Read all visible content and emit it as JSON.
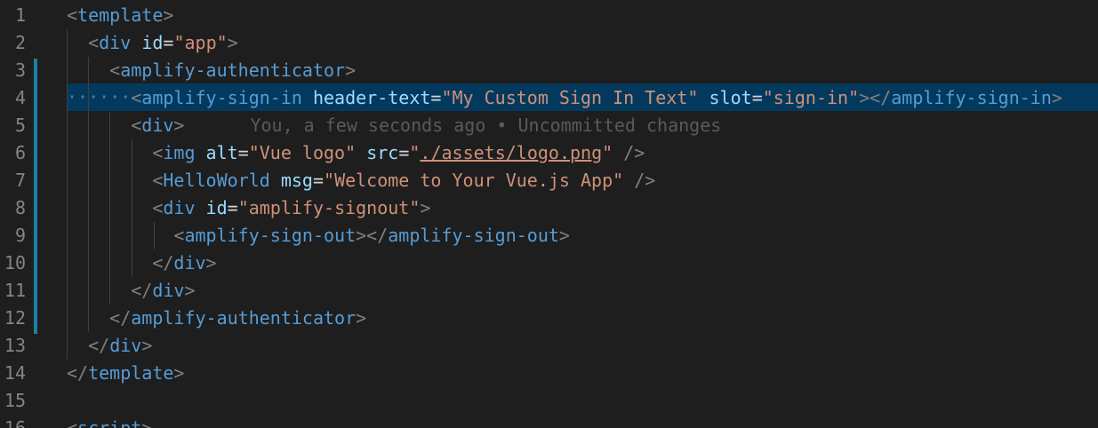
{
  "editor": {
    "line_numbers": [
      "1",
      "2",
      "3",
      "4",
      "5",
      "6",
      "7",
      "8",
      "9",
      "10",
      "11",
      "12",
      "13",
      "14",
      "15",
      "16"
    ],
    "blame": "You, a few seconds ago • Uncommitted changes",
    "lines": [
      {
        "indent": "",
        "tag": "template"
      },
      {
        "indent": "  ",
        "tag": "div",
        "attr": "id",
        "value": "app"
      },
      {
        "indent": "    ",
        "tag": "amplify-authenticator"
      },
      {
        "indent": "      ",
        "tag": "amplify-sign-in",
        "attr1": "header-text",
        "value1": "My Custom Sign In Text",
        "attr2": "slot",
        "value2": "sign-in",
        "close_tag": "amplify-sign-in"
      },
      {
        "indent": "      ",
        "tag": "div"
      },
      {
        "indent": "        ",
        "tag": "img",
        "attr1": "alt",
        "value1": "Vue logo",
        "attr2": "src",
        "value2": "./assets/logo.png"
      },
      {
        "indent": "        ",
        "tag": "HelloWorld",
        "attr": "msg",
        "value": "Welcome to Your Vue.js App"
      },
      {
        "indent": "        ",
        "tag": "div",
        "attr": "id",
        "value": "amplify-signout"
      },
      {
        "indent": "          ",
        "tag": "amplify-sign-out",
        "close_tag": "amplify-sign-out"
      },
      {
        "indent": "        ",
        "close_tag": "div"
      },
      {
        "indent": "      ",
        "close_tag": "div"
      },
      {
        "indent": "    ",
        "close_tag": "amplify-authenticator"
      },
      {
        "indent": "  ",
        "close_tag": "div"
      },
      {
        "indent": "",
        "close_tag": "template"
      },
      {
        "indent": ""
      },
      {
        "indent": "",
        "tag": "script"
      }
    ],
    "whitespace_marks": "······",
    "colors": {
      "background": "#1e1e1e",
      "line_highlight": "#04395e",
      "tag": "#569cd6",
      "attribute": "#9cdcfe",
      "string": "#ce9178",
      "punctuation": "#808080",
      "git_modified": "#1b81a8"
    }
  }
}
